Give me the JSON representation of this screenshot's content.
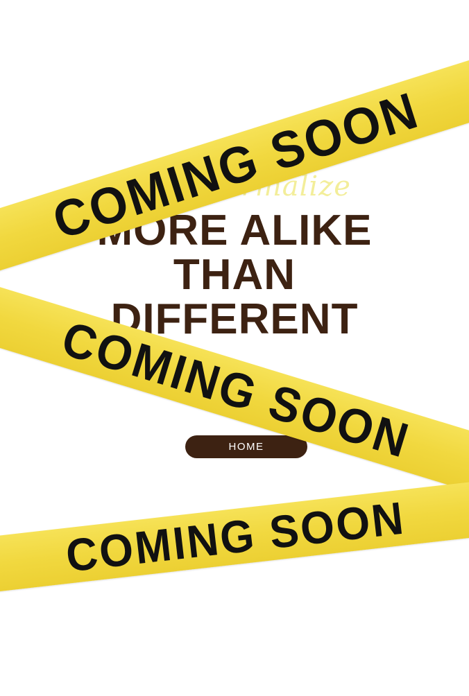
{
  "hero": {
    "tagline": "Let's Normalize",
    "headline_lines": [
      "MORE ALIKE",
      "THAN",
      "DIFFERENT"
    ]
  },
  "nav": {
    "home_label": "HOME"
  },
  "tapes": [
    {
      "label": "COMING SOON"
    },
    {
      "label": "COMING SOON"
    },
    {
      "label": "COMING SOON"
    }
  ],
  "colors": {
    "headline": "#3d2212",
    "tape": "#f1d83f",
    "tape_text": "#111111",
    "tagline": "#f3ee9a",
    "button_bg": "#3d2212",
    "button_text": "#ffffff",
    "background": "#ffffff"
  }
}
